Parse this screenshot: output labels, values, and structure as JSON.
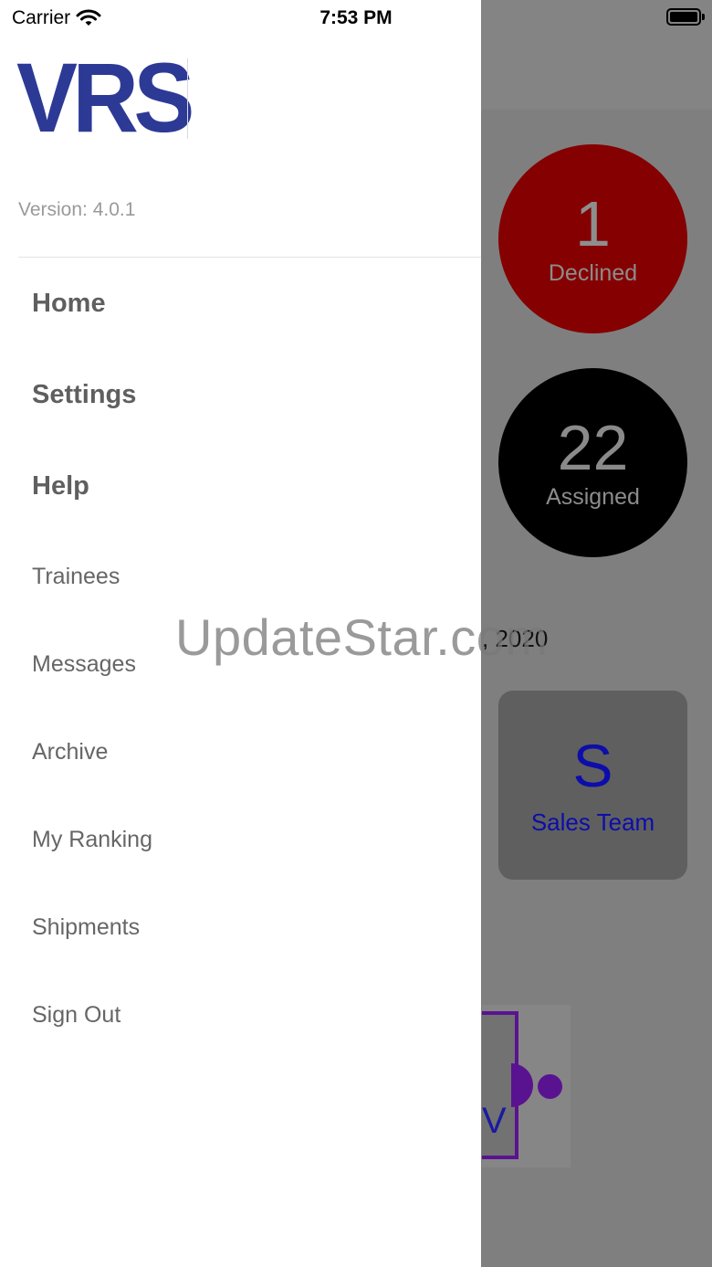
{
  "status_bar": {
    "carrier": "Carrier",
    "time": "7:53 PM",
    "icons": [
      "wifi-icon",
      "battery-icon"
    ]
  },
  "drawer": {
    "logo_text": "VRS",
    "version": "Version: 4.0.1",
    "menu": {
      "primary": [
        "Home",
        "Settings",
        "Help"
      ],
      "secondary": [
        "Trainees",
        "Messages",
        "Archive",
        "My Ranking",
        "Shipments",
        "Sign Out"
      ]
    }
  },
  "background": {
    "declined": {
      "count": "1",
      "label": "Declined"
    },
    "assigned": {
      "count": "22",
      "label": "Assigned"
    },
    "date_fragment": ", 2020",
    "team_card": {
      "initial": "S",
      "label": "Sales Team"
    },
    "logo_fragment": "V"
  },
  "watermark": "UpdateStar.com",
  "colors": {
    "brand": "#2d3a95",
    "declined": "#850000",
    "assigned": "#000000",
    "team_text": "#0d0dab",
    "logo_purple": "#5a1390",
    "overlay": "#7f7f7f"
  }
}
